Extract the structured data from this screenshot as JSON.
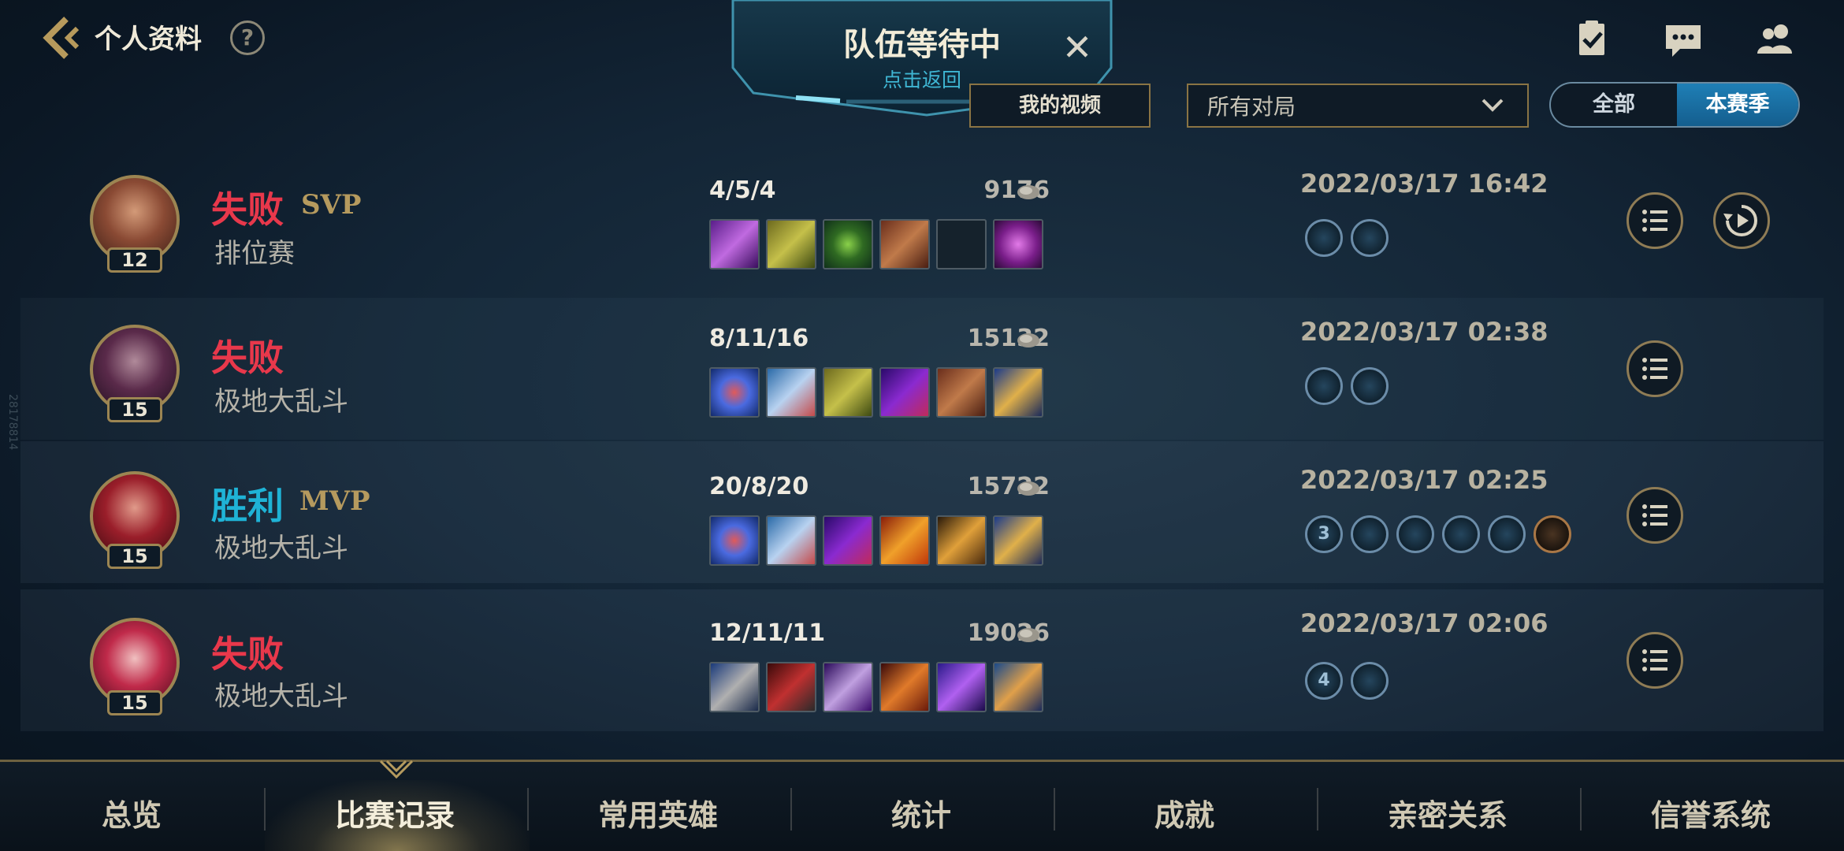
{
  "header": {
    "title": "个人资料",
    "help": "?",
    "icons": [
      "task-checklist-icon",
      "chat-bubble-icon",
      "friends-icon"
    ]
  },
  "queue_banner": {
    "title": "队伍等待中",
    "subtitle": "点击返回",
    "close": "✕"
  },
  "filters": {
    "my_videos": "我的视频",
    "match_filter": "所有对局",
    "segment": {
      "all": "全部",
      "this_season": "本赛季",
      "selected": "本赛季"
    }
  },
  "matches": [
    {
      "result": "失败",
      "outcome": "lose",
      "badge": "SVP",
      "mode": "排位赛",
      "level": "12",
      "kda": "4/5/4",
      "gold": "9176",
      "date": "2022/03/17 16:42",
      "medals": [
        "",
        ""
      ],
      "has_replay": true
    },
    {
      "result": "失败",
      "outcome": "lose",
      "badge": "",
      "mode": "极地大乱斗",
      "level": "15",
      "kda": "8/11/16",
      "gold": "15132",
      "date": "2022/03/17 02:38",
      "medals": [
        "",
        ""
      ],
      "has_replay": false
    },
    {
      "result": "胜利",
      "outcome": "win",
      "badge": "MVP",
      "mode": "极地大乱斗",
      "level": "15",
      "kda": "20/8/20",
      "gold": "15722",
      "date": "2022/03/17 02:25",
      "medals": [
        "3",
        "",
        "",
        "",
        "",
        ""
      ],
      "has_replay": false
    },
    {
      "result": "失败",
      "outcome": "lose",
      "badge": "",
      "mode": "极地大乱斗",
      "level": "15",
      "kda": "12/11/11",
      "gold": "19026",
      "date": "2022/03/17 02:06",
      "medals": [
        "4",
        ""
      ],
      "has_replay": false
    }
  ],
  "nav": {
    "items": [
      "总览",
      "比赛记录",
      "常用英雄",
      "统计",
      "成就",
      "亲密关系",
      "信誉系统"
    ],
    "active": "比赛记录"
  },
  "watermark": "28178814",
  "colors": {
    "lose": "#e8384b",
    "win": "#1fb3d6",
    "gold_frame": "#9c8552",
    "accent_blue": "#1f7fb6"
  }
}
